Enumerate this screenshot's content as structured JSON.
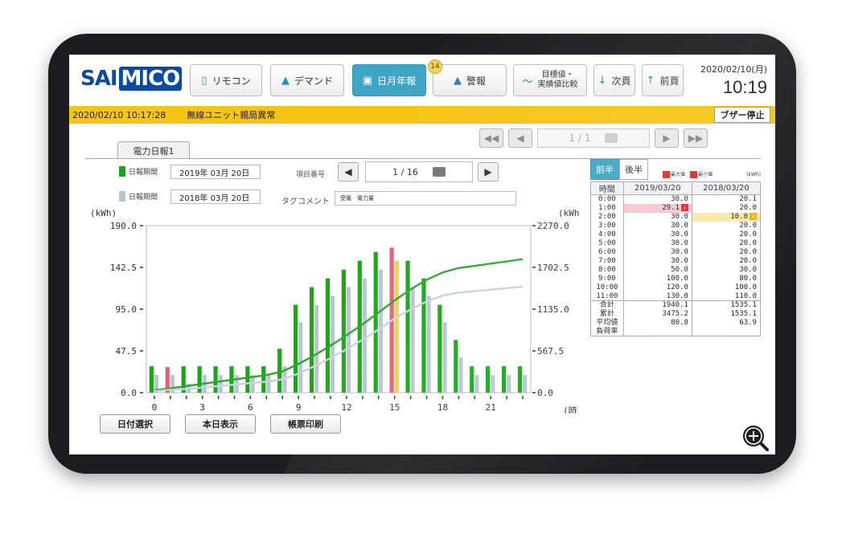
{
  "app": {
    "logo_prefix": "SAI",
    "logo_suffix": "MICO",
    "date": "2020/02/10(月)",
    "time": "10:19"
  },
  "nav": [
    {
      "label": "リモコン",
      "icon": "remote-icon"
    },
    {
      "label": "デマンド",
      "icon": "demand-chart-icon"
    },
    {
      "label": "日月年報",
      "icon": "calendar-icon",
      "active": true
    },
    {
      "label": "警報",
      "icon": "warning-icon",
      "badge": "14"
    },
    {
      "label_line1": "目標値・",
      "label_line2": "実績値比較",
      "icon": "trend-line-icon"
    },
    {
      "label": "次頁",
      "icon": "arrow-down-icon"
    },
    {
      "label": "前頁",
      "icon": "arrow-up-icon"
    }
  ],
  "alarm": {
    "timestamp": "2020/02/10 10:17:28",
    "message": "無線ユニット親局異常",
    "buzzer_label": "ブザー停止",
    "color": "#f6c513"
  },
  "page_pager": {
    "display": "1 / 1"
  },
  "tab": {
    "label": "電力日報1"
  },
  "period_primary": {
    "label": "日報期間",
    "value": "2019年 03月 20日",
    "color": "#1aa51a"
  },
  "period_compare": {
    "label": "日報期間",
    "value": "2018年 03月 20日",
    "color": "#b8c6d2"
  },
  "item": {
    "label": "項目番号",
    "display": "1 / 16"
  },
  "tag": {
    "label": "タグコメント",
    "value": "受電　電力量"
  },
  "buttons": {
    "date_select": "日付選択",
    "today": "本日表示",
    "print": "帳票印刷"
  },
  "table": {
    "half_first": "前半",
    "half_second": "後半",
    "legend_max": "最大値",
    "legend_min": "最小値",
    "unit": "(kWh)",
    "col_time": "時間",
    "col_a": "2019/03/20",
    "col_b": "2018/03/20",
    "rows": [
      {
        "time": "0:00",
        "a": "30.0",
        "b": "20.1"
      },
      {
        "time": "1:00",
        "a": "29.1",
        "b": "20.0",
        "a_flag": "min"
      },
      {
        "time": "2:00",
        "a": "30.0",
        "b": "10.0",
        "b_flag": "min"
      },
      {
        "time": "3:00",
        "a": "30.0",
        "b": "20.0"
      },
      {
        "time": "4:00",
        "a": "30.0",
        "b": "20.0"
      },
      {
        "time": "5:00",
        "a": "30.0",
        "b": "20.0"
      },
      {
        "time": "6:00",
        "a": "30.0",
        "b": "20.0"
      },
      {
        "time": "7:00",
        "a": "30.0",
        "b": "20.0"
      },
      {
        "time": "8:00",
        "a": "50.0",
        "b": "30.0"
      },
      {
        "time": "9:00",
        "a": "100.0",
        "b": "80.0"
      },
      {
        "time": "10:00",
        "a": "120.0",
        "b": "100.0"
      },
      {
        "time": "11:00",
        "a": "130.0",
        "b": "110.0"
      }
    ],
    "summary": [
      {
        "label": "合計",
        "a": "1940.1",
        "b": "1535.1"
      },
      {
        "label": "累計",
        "a": "3475.2",
        "b": "1535.1"
      },
      {
        "label": "平均値",
        "a": "80.8",
        "b": "63.9"
      },
      {
        "label": "負荷率",
        "a": "",
        "b": ""
      }
    ],
    "max_color": "#e52b2b",
    "min_color": "#e52b2b",
    "min_yellow": "#f0b400"
  },
  "chart_data": {
    "type": "bar",
    "ylabel_left": "(kWh)",
    "ylabel_right": "(kWh)",
    "xlabel": "(時)",
    "ylim_left": [
      0,
      190
    ],
    "ylim_right": [
      0,
      2270
    ],
    "yticks_left": [
      "0.0",
      "47.5",
      "95.0",
      "142.5",
      "190.0"
    ],
    "yticks_right": [
      "0.0",
      "567.5",
      "1135.0",
      "1702.5",
      "2270.0"
    ],
    "xticks": [
      "0",
      "3",
      "6",
      "9",
      "12",
      "15",
      "18",
      "21"
    ],
    "hours": [
      0,
      1,
      2,
      3,
      4,
      5,
      6,
      7,
      8,
      9,
      10,
      11,
      12,
      13,
      14,
      15,
      16,
      17,
      18,
      19,
      20,
      21,
      22,
      23
    ],
    "series": [
      {
        "name": "2019年 03月 20日",
        "color": "#1aa51a",
        "values": [
          30,
          29.1,
          30,
          30,
          30,
          30,
          30,
          30,
          50,
          100,
          120,
          130,
          140,
          150,
          160,
          165,
          150,
          130,
          100,
          60,
          30,
          30,
          30,
          30
        ],
        "highlight": {
          "1": "#e0607a",
          "15": "#e0607a"
        }
      },
      {
        "name": "2018年 03月 20日",
        "color": "#b8c6d2",
        "values": [
          20.1,
          20,
          10,
          20,
          20,
          20,
          20,
          20,
          30,
          80,
          100,
          110,
          120,
          130,
          140,
          150,
          120,
          110,
          80,
          40,
          20,
          20,
          20,
          20
        ],
        "highlight": {
          "15": "#f0d04a"
        }
      }
    ],
    "cumulative_colors": [
      "#2fa52f",
      "#c7d3de"
    ],
    "grid": false
  }
}
